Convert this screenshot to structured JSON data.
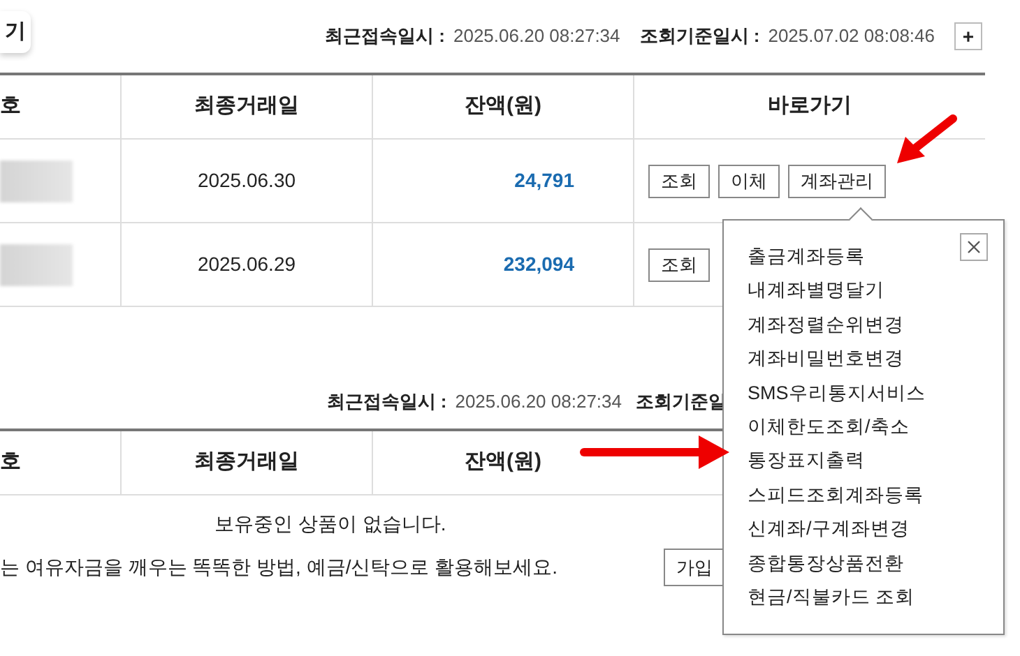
{
  "tab": {
    "label": "기"
  },
  "top_info": {
    "last_access_label": "최근접속일시 :",
    "last_access_value": "2025.06.20 08:27:34",
    "query_label": "조회기준일시 :",
    "query_value": "2025.07.02 08:08:46",
    "expand_button": "+"
  },
  "accounts_table": {
    "columns": [
      "호",
      "최종거래일",
      "잔액(원)",
      "바로가기"
    ],
    "rows": [
      {
        "last_transaction": "2025.06.30",
        "balance": "24,791",
        "actions": [
          "조회",
          "이체",
          "계좌관리"
        ]
      },
      {
        "last_transaction": "2025.06.29",
        "balance": "232,094",
        "actions": [
          "조회"
        ]
      }
    ]
  },
  "account_menu": {
    "items": [
      "출금계좌등록",
      "내계좌별명달기",
      "계좌정렬순위변경",
      "계좌비밀번호변경",
      "SMS우리통지서비스",
      "이체한도조회/축소",
      "통장표지출력",
      "스피드조회계좌등록",
      "신계좌/구계좌변경",
      "종합통장상품전환",
      "현금/직불카드 조회"
    ]
  },
  "second_info": {
    "last_access_label": "최근접속일시 :",
    "last_access_value": "2025.06.20 08:27:34",
    "query_label": "조회기준일"
  },
  "products_table": {
    "columns": [
      "호",
      "최종거래일",
      "잔액(원)"
    ],
    "empty_message": "보유중인 상품이 없습니다.",
    "promo_message": "는 여유자금을 깨우는 똑똑한 방법, 예금/신탁으로 활용해보세요.",
    "join_button": "가입"
  }
}
